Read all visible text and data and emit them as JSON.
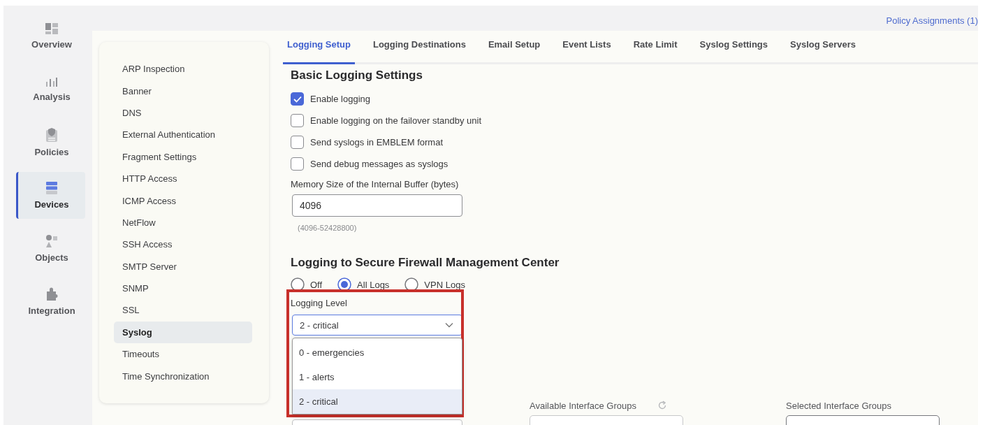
{
  "nav": [
    {
      "label": "Overview",
      "kind": "overview",
      "selected": false
    },
    {
      "label": "Analysis",
      "kind": "analysis",
      "selected": false
    },
    {
      "label": "Policies",
      "kind": "policies",
      "selected": false
    },
    {
      "label": "Devices",
      "kind": "devices",
      "selected": true
    },
    {
      "label": "Objects",
      "kind": "objects",
      "selected": false
    },
    {
      "label": "Integration",
      "kind": "integration",
      "selected": false
    }
  ],
  "header": {
    "link": "Policy Assignments (1)"
  },
  "settings_menu": [
    {
      "label": "ARP Inspection",
      "selected": false
    },
    {
      "label": "Banner",
      "selected": false
    },
    {
      "label": "DNS",
      "selected": false
    },
    {
      "label": "External Authentication",
      "selected": false
    },
    {
      "label": "Fragment Settings",
      "selected": false
    },
    {
      "label": "HTTP Access",
      "selected": false
    },
    {
      "label": "ICMP Access",
      "selected": false
    },
    {
      "label": "NetFlow",
      "selected": false
    },
    {
      "label": "SSH Access",
      "selected": false
    },
    {
      "label": "SMTP Server",
      "selected": false
    },
    {
      "label": "SNMP",
      "selected": false
    },
    {
      "label": "SSL",
      "selected": false
    },
    {
      "label": "Syslog",
      "selected": true
    },
    {
      "label": "Timeouts",
      "selected": false
    },
    {
      "label": "Time Synchronization",
      "selected": false
    }
  ],
  "tabs": [
    {
      "label": "Logging Setup",
      "selected": true
    },
    {
      "label": "Logging Destinations",
      "selected": false
    },
    {
      "label": "Email Setup",
      "selected": false
    },
    {
      "label": "Event Lists",
      "selected": false
    },
    {
      "label": "Rate Limit",
      "selected": false
    },
    {
      "label": "Syslog Settings",
      "selected": false
    },
    {
      "label": "Syslog Servers",
      "selected": false
    }
  ],
  "basic": {
    "title": "Basic Logging Settings",
    "options": [
      {
        "label": "Enable logging",
        "checked": true
      },
      {
        "label": "Enable logging on the failover standby unit",
        "checked": false
      },
      {
        "label": "Send syslogs in EMBLEM format",
        "checked": false
      },
      {
        "label": "Send debug messages as syslogs",
        "checked": false
      }
    ],
    "buffer": {
      "label": "Memory Size of the Internal Buffer (bytes)",
      "value": "4096",
      "hint": "(4096-52428800)"
    }
  },
  "fmc": {
    "title": "Logging to Secure Firewall Management Center",
    "modes": [
      {
        "label": "Off",
        "selected": false
      },
      {
        "label": "All Logs",
        "selected": true
      },
      {
        "label": "VPN Logs",
        "selected": false
      }
    ],
    "logging_level": {
      "label": "Logging Level",
      "value": "2 - critical",
      "expanded": true,
      "highlighted": true,
      "options": [
        {
          "label": "0 - emergencies",
          "selected": false
        },
        {
          "label": "1 - alerts",
          "selected": false
        },
        {
          "label": "2 - critical",
          "selected": true
        }
      ]
    }
  },
  "interface_groups": {
    "available": {
      "label": "Available Interface Groups"
    },
    "selected": {
      "label": "Selected Interface Groups"
    }
  }
}
